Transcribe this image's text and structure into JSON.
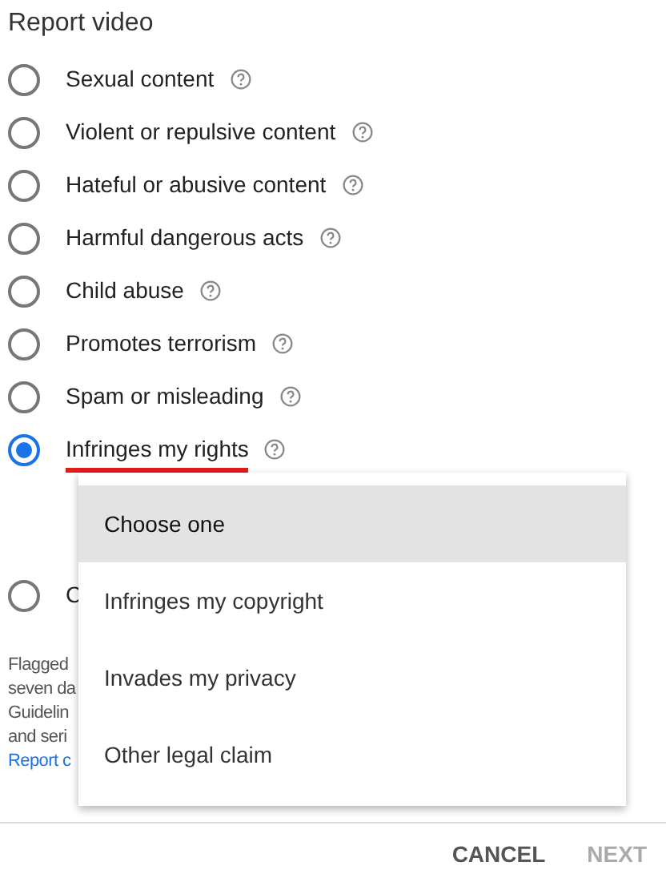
{
  "dialog": {
    "title": "Report video"
  },
  "reasons": [
    {
      "label": "Sexual content",
      "selected": false,
      "underlined": false
    },
    {
      "label": "Violent or repulsive content",
      "selected": false,
      "underlined": false
    },
    {
      "label": "Hateful or abusive content",
      "selected": false,
      "underlined": false
    },
    {
      "label": "Harmful dangerous acts",
      "selected": false,
      "underlined": false
    },
    {
      "label": "Child abuse",
      "selected": false,
      "underlined": false
    },
    {
      "label": "Promotes terrorism",
      "selected": false,
      "underlined": false
    },
    {
      "label": "Spam or misleading",
      "selected": false,
      "underlined": false
    },
    {
      "label": "Infringes my rights",
      "selected": true,
      "underlined": true
    }
  ],
  "hidden_reason": {
    "label": "C",
    "selected": false
  },
  "notice": {
    "lines": [
      "Flagged",
      "seven da",
      "Guidelin",
      "and seri"
    ],
    "link": "Report c"
  },
  "menu": {
    "items": [
      {
        "label": "Choose one",
        "selected": true
      },
      {
        "label": "Infringes my copyright",
        "selected": false
      },
      {
        "label": "Invades my privacy",
        "selected": false
      },
      {
        "label": "Other legal claim",
        "selected": false
      }
    ]
  },
  "buttons": [
    {
      "label": "CANCEL",
      "disabled": false
    },
    {
      "label": "NEXT",
      "disabled": true
    }
  ]
}
